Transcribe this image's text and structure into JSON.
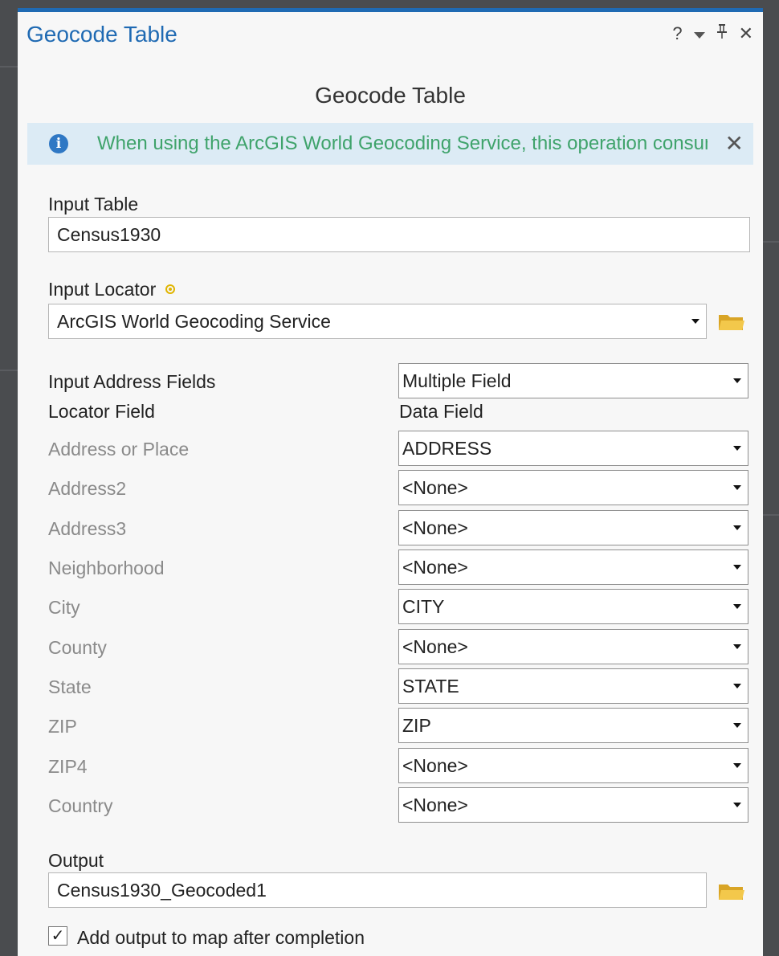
{
  "pane": {
    "title": "Geocode Table",
    "help": "?",
    "close": "✕"
  },
  "tool": {
    "title": "Geocode Table"
  },
  "info": {
    "message": "When using the ArcGIS World Geocoding Service, this operation consumes credits."
  },
  "input_table": {
    "label": "Input Table",
    "value": "Census1930"
  },
  "input_locator": {
    "label": "Input Locator",
    "value": "ArcGIS World Geocoding Service"
  },
  "address_fields": {
    "label": "Input Address Fields",
    "value": "Multiple Field"
  },
  "columns": {
    "locator_field": "Locator Field",
    "data_field": "Data Field"
  },
  "field_map": [
    {
      "locator": "Address or Place",
      "data": "ADDRESS"
    },
    {
      "locator": "Address2",
      "data": "<None>"
    },
    {
      "locator": "Address3",
      "data": "<None>"
    },
    {
      "locator": "Neighborhood",
      "data": "<None>"
    },
    {
      "locator": "City",
      "data": "CITY"
    },
    {
      "locator": "County",
      "data": "<None>"
    },
    {
      "locator": "State",
      "data": "STATE"
    },
    {
      "locator": "ZIP",
      "data": "ZIP"
    },
    {
      "locator": "ZIP4",
      "data": "<None>"
    },
    {
      "locator": "Country",
      "data": "<None>"
    }
  ],
  "output": {
    "label": "Output",
    "value": "Census1930_Geocoded1"
  },
  "add_to_map": {
    "label": "Add output to map after completion",
    "checked": true
  }
}
